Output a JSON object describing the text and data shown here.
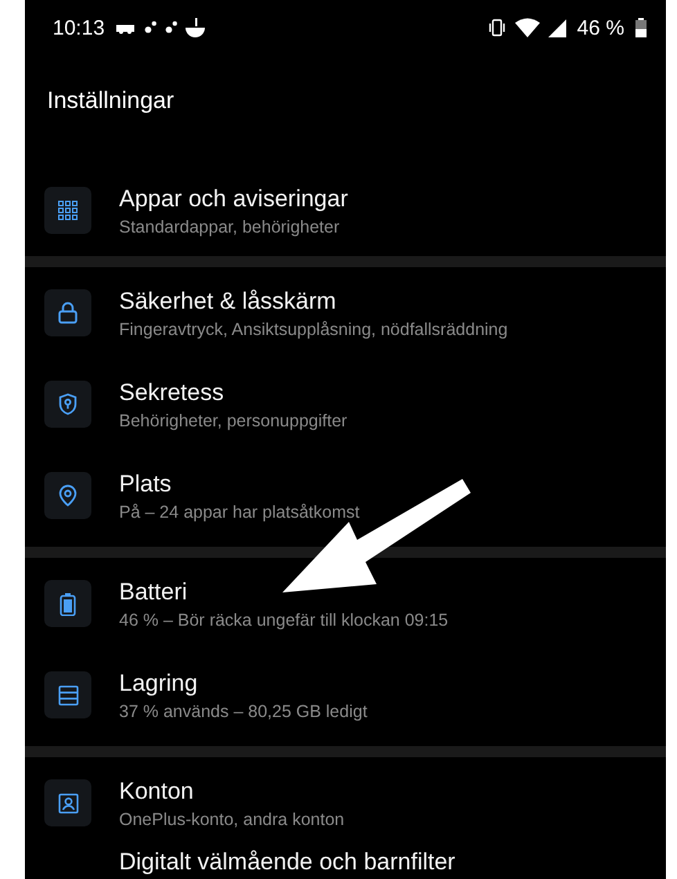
{
  "status_bar": {
    "time": "10:13",
    "battery": "46 %"
  },
  "title": "Inställningar",
  "sections": [
    {
      "items": [
        {
          "kind": "grid",
          "title": "Appar och aviseringar",
          "subtitle": "Standardappar, behörigheter"
        }
      ]
    },
    {
      "items": [
        {
          "kind": "lock",
          "title": "Säkerhet & låsskärm",
          "subtitle": "Fingeravtryck, Ansiktsupplåsning, nödfallsräddning"
        },
        {
          "kind": "shield",
          "title": "Sekretess",
          "subtitle": "Behörigheter, personuppgifter"
        },
        {
          "kind": "pin",
          "title": "Plats",
          "subtitle": "På – 24 appar har platsåtkomst"
        }
      ]
    },
    {
      "items": [
        {
          "kind": "battery",
          "title": "Batteri",
          "subtitle": "46 % – Bör räcka ungefär till klockan 09:15"
        },
        {
          "kind": "storage",
          "title": "Lagring",
          "subtitle": "37 % används – 80,25 GB ledigt"
        }
      ]
    },
    {
      "items": [
        {
          "kind": "account",
          "title": "Konton",
          "subtitle": "OnePlus-konto, andra konton"
        },
        {
          "kind": "partial",
          "title": "Digitalt välmående och barnfilter"
        }
      ]
    }
  ],
  "annotations": [
    {
      "kind": "arrow"
    }
  ]
}
